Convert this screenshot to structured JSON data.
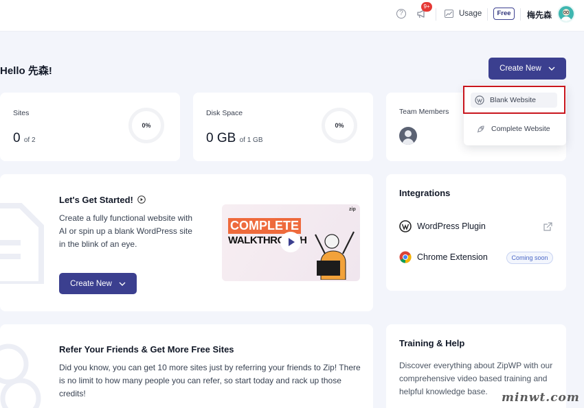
{
  "header": {
    "notification_count": "9+",
    "usage_label": "Usage",
    "plan_badge": "Free",
    "username": "梅先森"
  },
  "greeting": "Hello 先森!",
  "create_new_label": "Create New",
  "stats": {
    "sites": {
      "label": "Sites",
      "value": "0",
      "suffix": "of 2",
      "percent": "0%"
    },
    "disk": {
      "label": "Disk Space",
      "value": "0 GB",
      "suffix": "of 1 GB",
      "percent": "0%"
    },
    "team": {
      "label": "Team Members"
    }
  },
  "dropdown": {
    "items": [
      {
        "label": "Blank Website",
        "icon": "wordpress-icon"
      },
      {
        "label": "Complete Website",
        "icon": "rocket-icon"
      }
    ]
  },
  "get_started": {
    "title": "Let's Get Started!",
    "description": "Create a fully functional website with AI or spin up a blank WordPress site in the blink of an eye.",
    "button_label": "Create New",
    "video_line1": "COMPLETE",
    "video_line2": "WALKTHROUGH",
    "video_logo": "zip"
  },
  "integrations": {
    "title": "Integrations",
    "items": [
      {
        "label": "WordPress Plugin",
        "icon": "wordpress-icon",
        "action": "external-link-icon"
      },
      {
        "label": "Chrome Extension",
        "icon": "chrome-icon",
        "badge": "Coming soon"
      }
    ]
  },
  "refer": {
    "title": "Refer Your Friends & Get More Free Sites",
    "description": "Did you know, you can get 10 more sites just by referring your friends to Zip! There is no limit to how many people you can refer, so start today and rack up those credits!"
  },
  "training": {
    "title": "Training & Help",
    "description": "Discover everything about ZipWP with our comprehensive video based training and helpful knowledge base."
  },
  "watermark": "minwt.com",
  "colors": {
    "primary": "#3b3f8f",
    "badge_red": "#e53935",
    "highlight_red": "#c8141c",
    "background": "#f3f5fb"
  }
}
